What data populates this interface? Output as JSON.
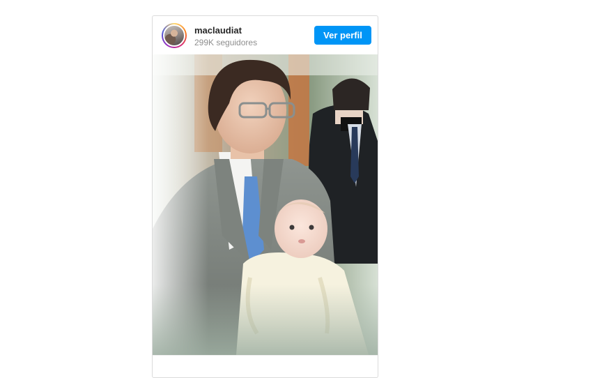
{
  "embed": {
    "username": "maclaudiat",
    "followers": "299K seguidores",
    "profile_button_label": "Ver perfil",
    "avatar_icon": "profile-avatar",
    "photo_icon": "post-photo",
    "colors": {
      "button_bg": "#0095f6",
      "username": "#262626",
      "secondary_text": "#8e8e8e",
      "border": "#dbdbdb"
    }
  }
}
